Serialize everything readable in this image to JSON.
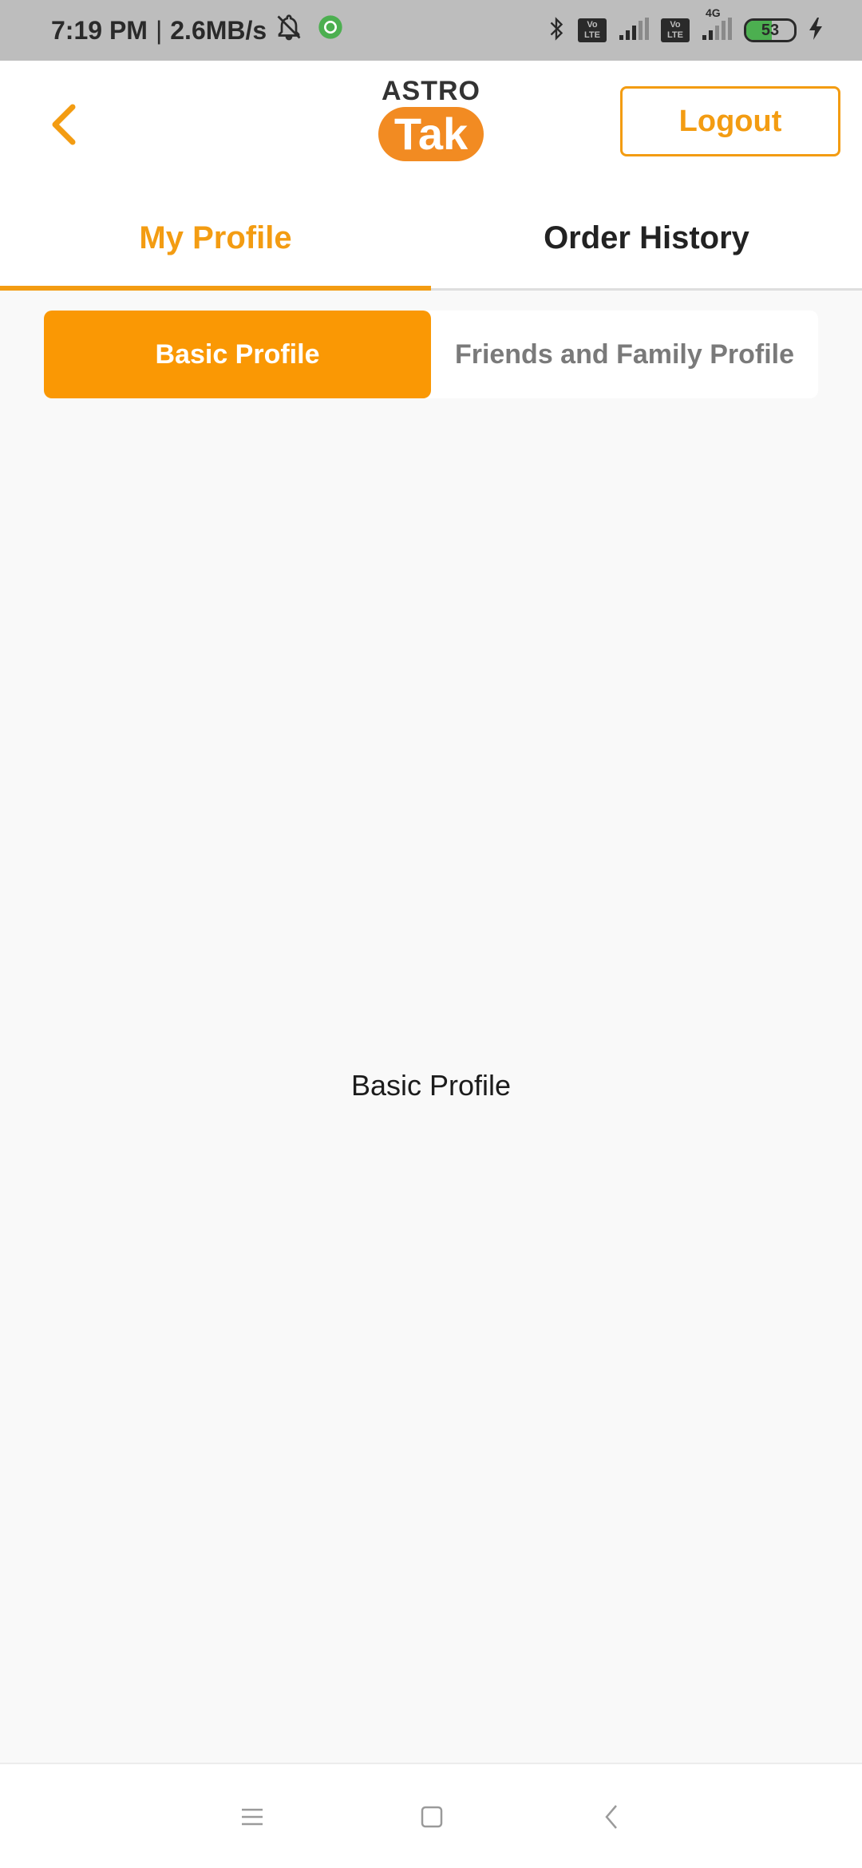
{
  "status_bar": {
    "time": "7:19 PM",
    "separator": "|",
    "speed": "2.6MB/s",
    "volte_top": "Vo",
    "volte_bottom": "LTE",
    "network_label": "4G",
    "battery": "53",
    "battery_fill_fraction": 0.53,
    "icons": [
      "alarm-off-icon",
      "app-notification-icon",
      "bluetooth-icon",
      "signal-icon",
      "charging-icon"
    ]
  },
  "header": {
    "logo_top": "ASTRO",
    "logo_bottom": "Tak",
    "logout_label": "Logout",
    "accent_color": "#f39c12"
  },
  "main_tabs": [
    {
      "label": "My Profile",
      "active": true
    },
    {
      "label": "Order History",
      "active": false
    }
  ],
  "sub_tabs": [
    {
      "label": "Basic Profile",
      "active": true
    },
    {
      "label": "Friends and Family Profile",
      "active": false
    }
  ],
  "content": {
    "label": "Basic Profile"
  },
  "nav_bar": {
    "icons": [
      "menu-icon",
      "home-icon",
      "back-icon"
    ]
  }
}
